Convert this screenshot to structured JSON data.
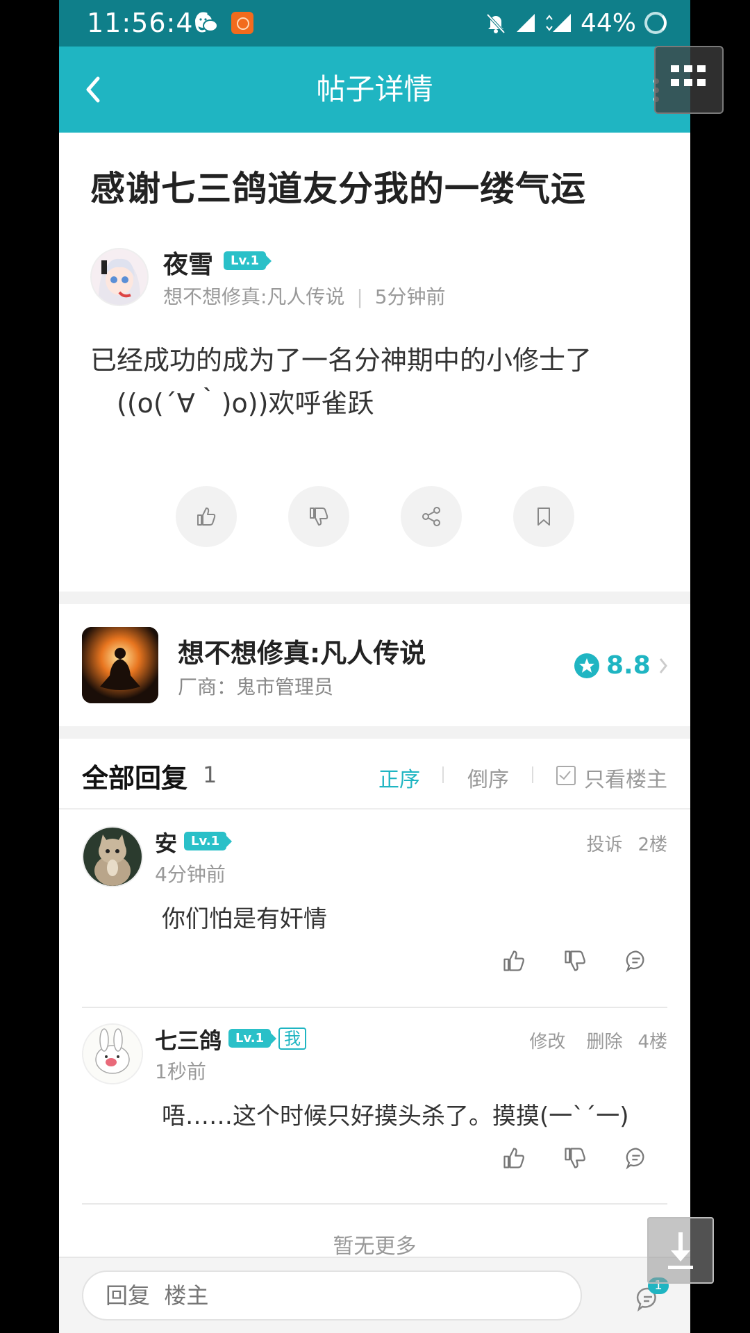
{
  "status_bar": {
    "time": "11:56:46",
    "battery": "44%"
  },
  "header": {
    "title": "帖子详情"
  },
  "post": {
    "title": "感谢七三鸽道友分我的一缕气运",
    "author": "夜雪",
    "level": "Lv.1",
    "source": "想不想修真:凡人传说",
    "time": "5分钟前",
    "meta_sep": "|",
    "body_line1": "已经成功的成为了一名分神期中的小修士了",
    "body_line2": "((o(´∀｀)o))欢呼雀跃"
  },
  "game": {
    "name": "想不想修真:凡人传说",
    "vendor": "厂商：鬼市管理员",
    "rating": "8.8"
  },
  "replies": {
    "heading": "全部回复",
    "count": "1",
    "sort_asc": "正序",
    "sort_desc": "倒序",
    "only_op": "只看楼主",
    "items": [
      {
        "name": "安",
        "level": "Lv.1",
        "time": "4分钟前",
        "body": "你们怕是有奸情",
        "report": "投诉",
        "floor": "2楼"
      },
      {
        "name": "七三鸽",
        "level": "Lv.1",
        "me_tag": "我",
        "time": "1秒前",
        "body": "唔……这个时候只好摸头杀了。摸摸(一`´一)",
        "edit": "修改",
        "delete": "删除",
        "floor": "4楼"
      }
    ],
    "no_more": "暂无更多"
  },
  "composer": {
    "placeholder": "回复  楼主",
    "badge": "1"
  },
  "colors": {
    "accent": "#1fb5c2",
    "status_bar": "#0f7f8a"
  }
}
